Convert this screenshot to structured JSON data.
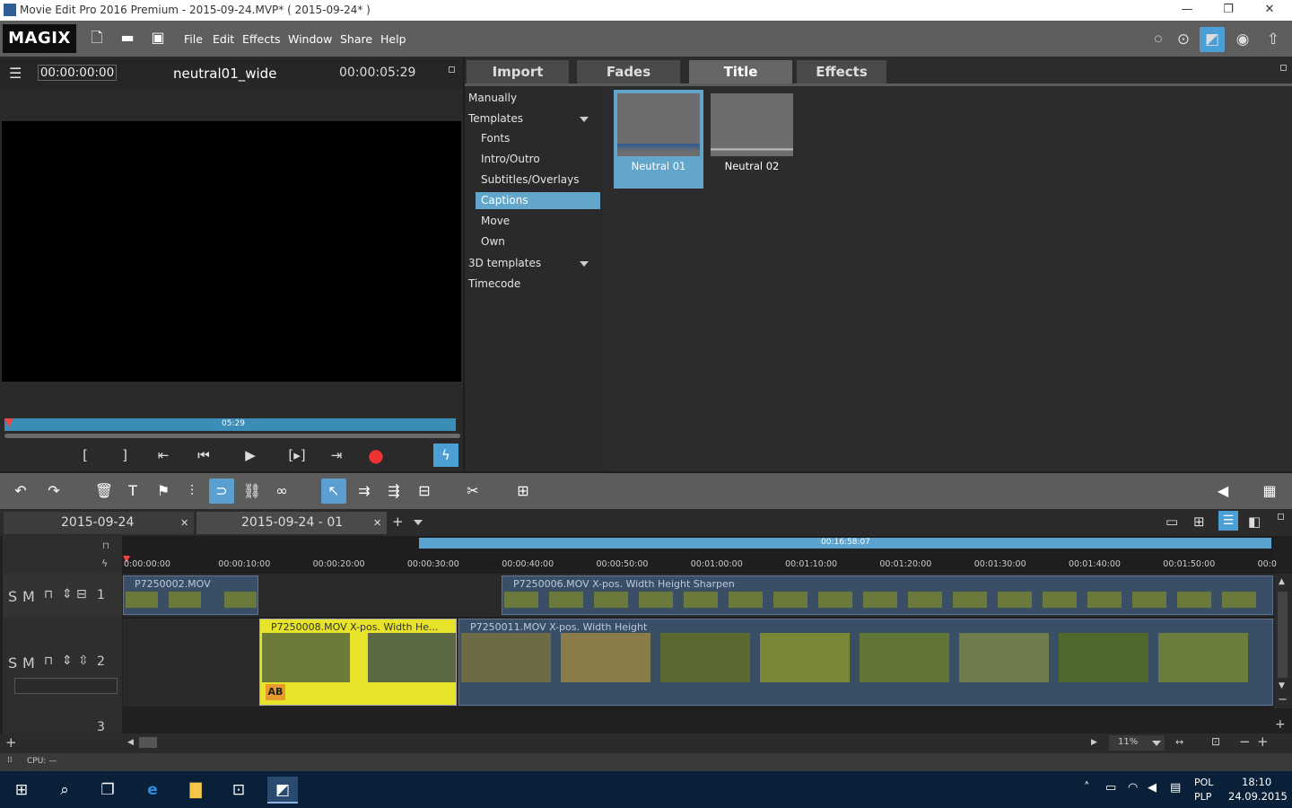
{
  "window": {
    "title": "Movie Edit Pro 2016 Premium - 2015-09-24.MVP* ( 2015-09-24* )",
    "min": "—",
    "max": "❐",
    "close": "✕"
  },
  "app": {
    "logo": "MAGIX",
    "menu": [
      "File",
      "Edit",
      "Effects",
      "Window",
      "Share",
      "Help"
    ]
  },
  "preview": {
    "timecode": "00:00:00:00",
    "name": "neutral01_wide",
    "duration": "00:00:05:29",
    "bar_label": "05:29",
    "progress": 0
  },
  "mediapool": {
    "tabs": [
      "Import",
      "Fades",
      "Title",
      "Effects"
    ],
    "active_tab": "Title",
    "tree": [
      {
        "label": "Manually"
      },
      {
        "label": "Templates"
      },
      {
        "label": "Fonts"
      },
      {
        "label": "Intro/Outro"
      },
      {
        "label": "Subtitles/Overlays"
      },
      {
        "label": "Captions"
      },
      {
        "label": "Move"
      },
      {
        "label": "Own"
      },
      {
        "label": "3D templates"
      },
      {
        "label": "Timecode"
      }
    ],
    "thumbs": [
      "Neutral 01",
      "Neutral 02"
    ]
  },
  "project_tabs": [
    "2015-09-24",
    "2015-09-24 - 01"
  ],
  "timeline": {
    "range_label": "00:16:58:07",
    "ticks": [
      "0:00:00:00",
      "00:00:10:00",
      "00:00:20:00",
      "00:00:30:00",
      "00:00:40:00",
      "00:00:50:00",
      "00:01:00:00",
      "00:01:10:00",
      "00:01:20:00",
      "00:01:30:00",
      "00:01:40:00",
      "00:01:50:00",
      "00:0"
    ],
    "tracks": [
      {
        "num": "1",
        "s": "S",
        "m": "M"
      },
      {
        "num": "2",
        "s": "S",
        "m": "M"
      },
      {
        "num": "3"
      }
    ],
    "clips": {
      "c1": "P7250002.MOV",
      "c2": "P7250006.MOV  X-pos.  Width  Height  Sharpen",
      "c3": "P7250008.MOV  X-pos.  Width  He...",
      "c4": "P7250011.MOV  X-pos.  Width  Height"
    },
    "ab_label": "AB",
    "zoom": "11%"
  },
  "cpu": "CPU: —",
  "taskbar": {
    "lang1": "POL",
    "lang2": "PLP",
    "time": "18:10",
    "date": "24.09.2015"
  }
}
